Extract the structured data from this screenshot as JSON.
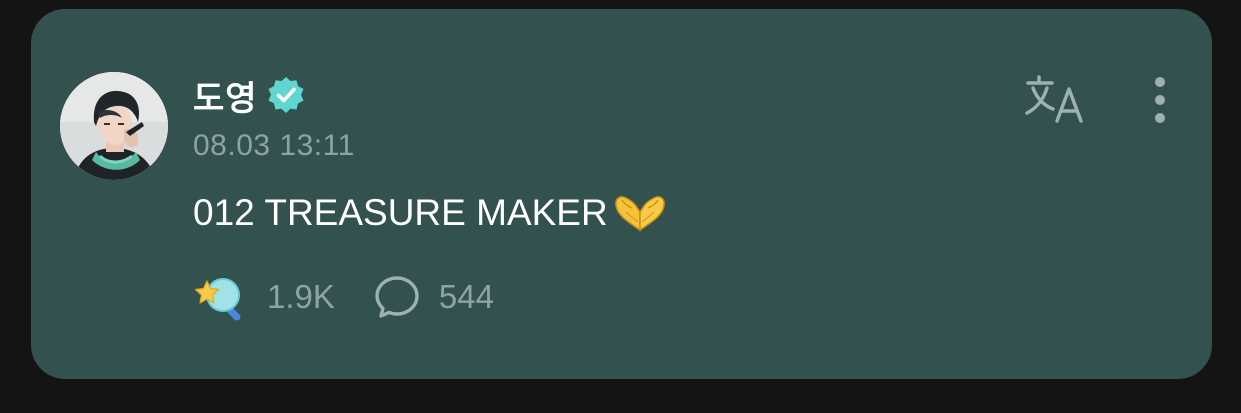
{
  "post": {
    "author": "도영",
    "timestamp": "08.03 13:11",
    "text": "012 TREASURE MAKER",
    "text_emoji": "heart-hands",
    "reaction_count": "1.9K",
    "comment_count": "544"
  },
  "icons": {
    "verified": "verified-badge-icon",
    "translate": "translate-icon",
    "more": "more-vertical-icon",
    "reaction": "star-wand-reaction-icon",
    "comment": "comment-bubble-icon"
  },
  "colors": {
    "background": "#141414",
    "card": "#32514f",
    "text_primary": "#ffffff",
    "text_secondary": "#8fa3a1",
    "verified_badge": "#5fd6cf",
    "icon": "#9db2b0"
  }
}
